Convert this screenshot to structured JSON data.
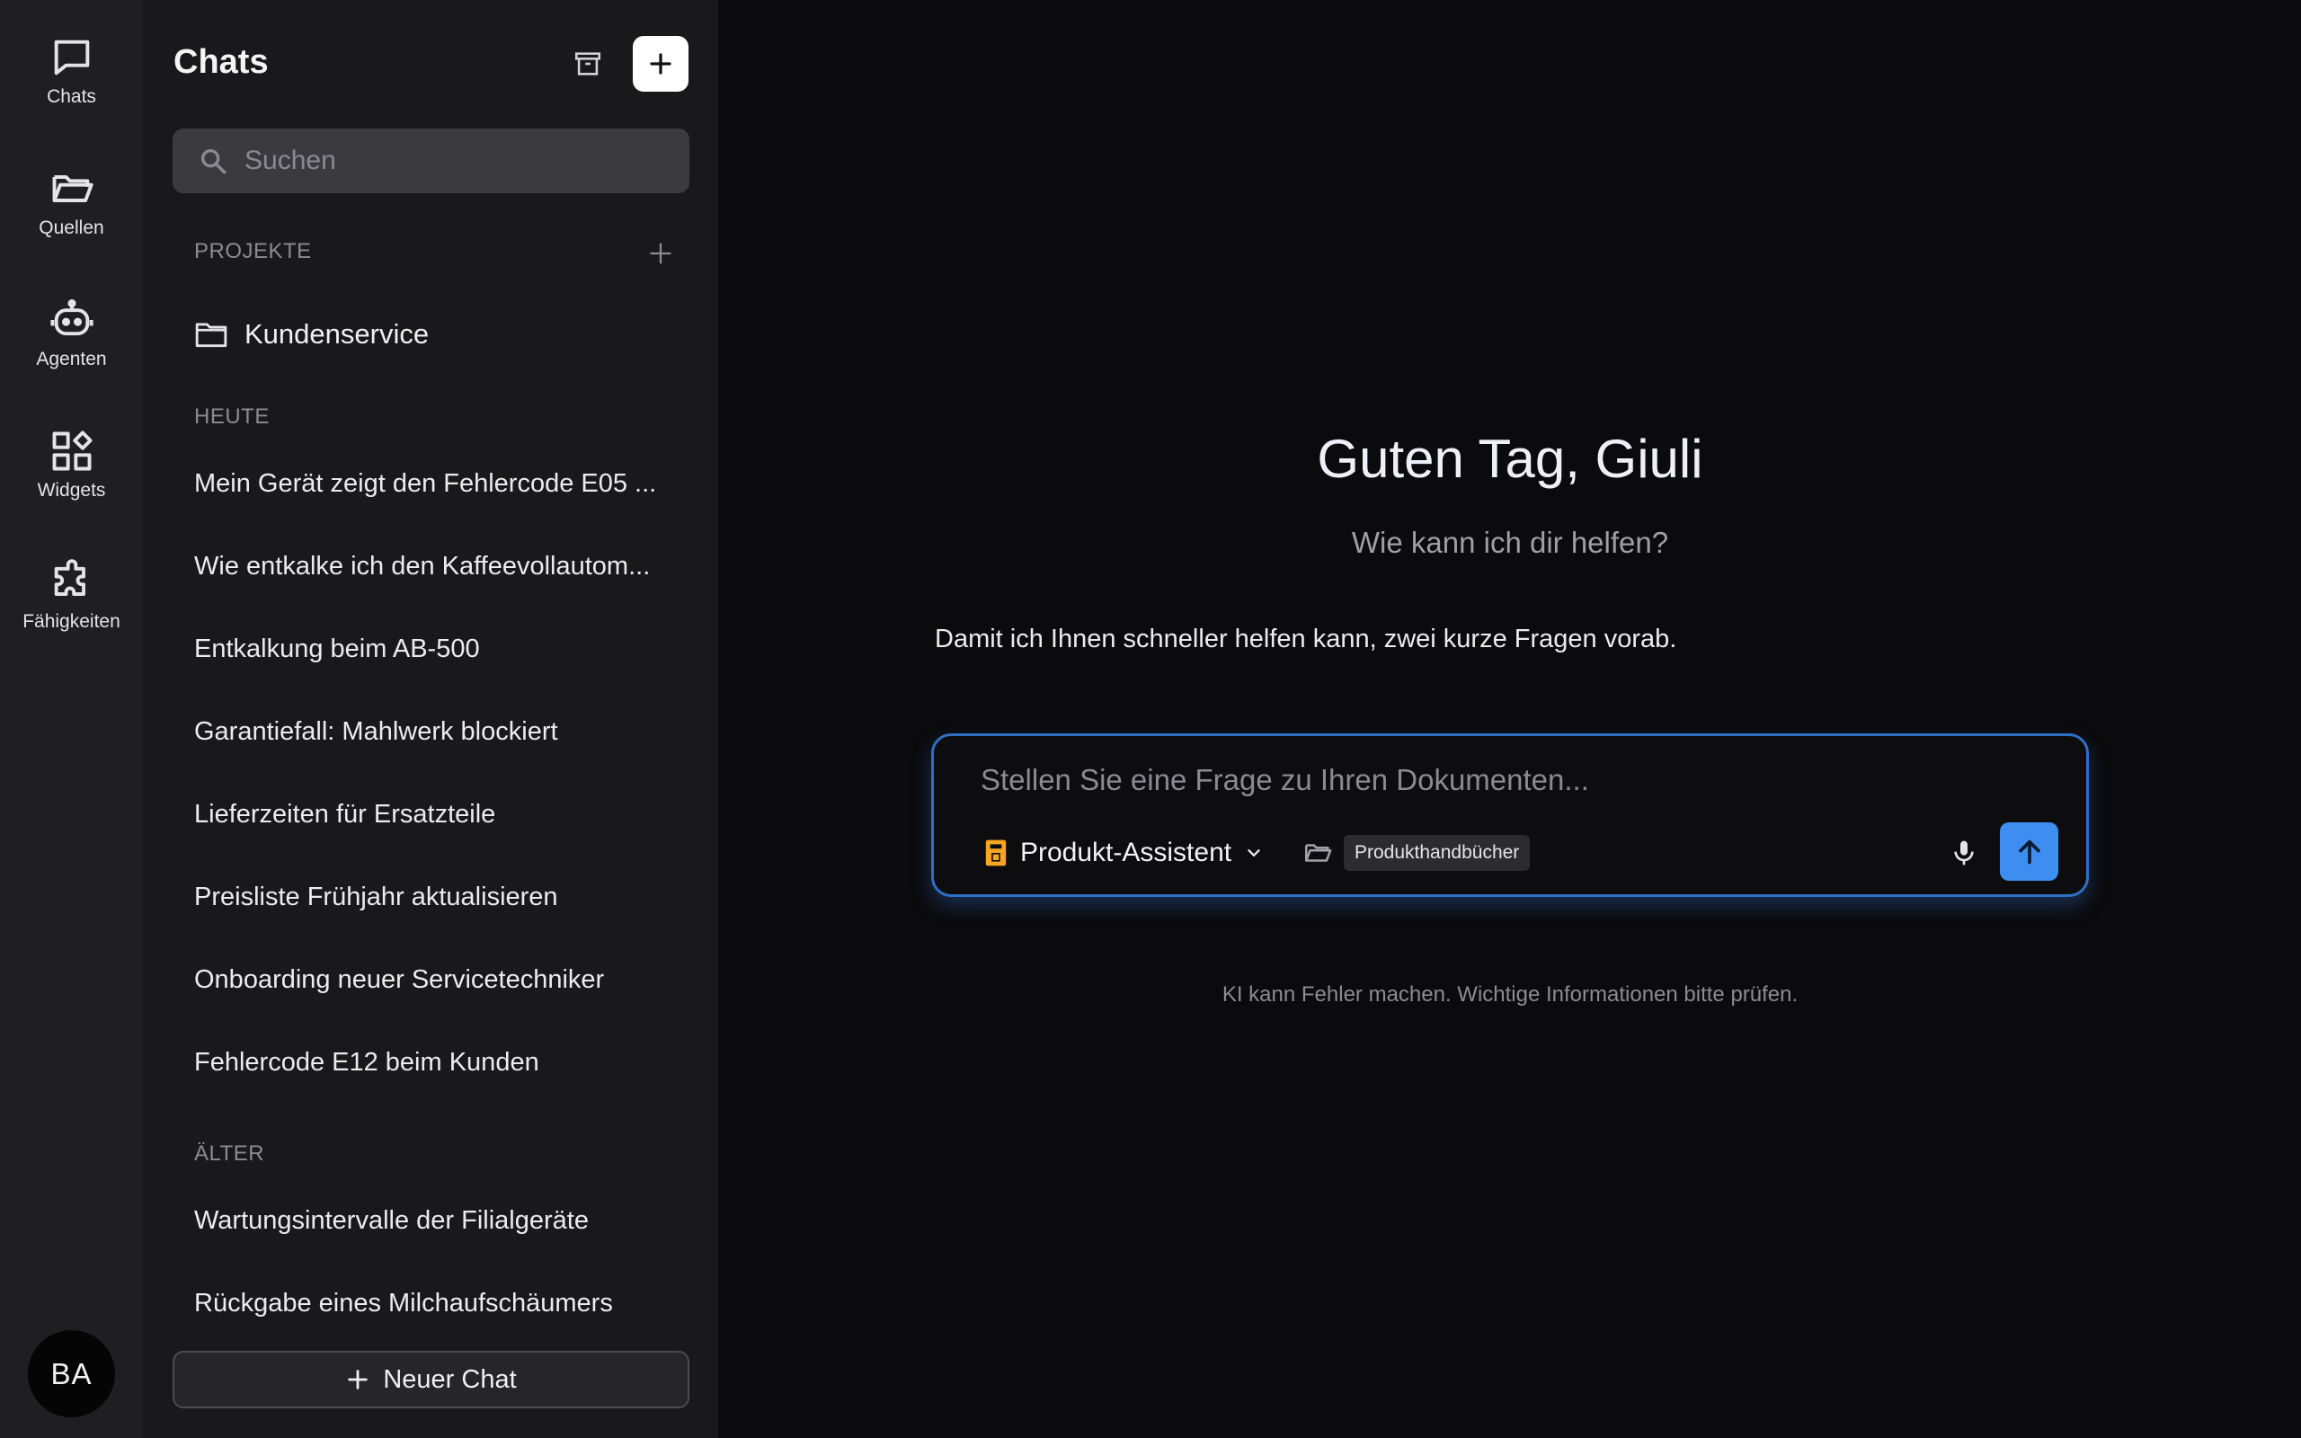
{
  "rail": {
    "items": [
      {
        "label": "Chats",
        "icon": "chat-bubble-icon"
      },
      {
        "label": "Quellen",
        "icon": "folder-open-icon"
      },
      {
        "label": "Agenten",
        "icon": "robot-icon"
      },
      {
        "label": "Widgets",
        "icon": "widgets-icon"
      },
      {
        "label": "Fähigkeiten",
        "icon": "puzzle-icon"
      }
    ],
    "avatar": "BA"
  },
  "panel": {
    "title": "Chats",
    "search_placeholder": "Suchen",
    "projects_header": "PROJEKTE",
    "projects": [
      "Kundenservice"
    ],
    "today_header": "HEUTE",
    "today": [
      "Mein Gerät zeigt den Fehlercode E05 ...",
      "Wie entkalke ich den Kaffeevollautom...",
      "Entkalkung beim AB-500",
      "Garantiefall: Mahlwerk blockiert",
      "Lieferzeiten für Ersatzteile",
      "Preisliste Frühjahr aktualisieren",
      "Onboarding neuer Servicetechniker",
      "Fehlercode E12 beim Kunden"
    ],
    "older_header": "ÄLTER",
    "older": [
      "Wartungsintervalle der Filialgeräte",
      "Rückgabe eines Milchaufschäumers"
    ],
    "new_chat_label": "Neuer Chat"
  },
  "main": {
    "greeting": "Guten Tag, Giuli",
    "subtitle": "Wie kann ich dir helfen?",
    "intro": "Damit ich Ihnen schneller helfen kann, zwei kurze Fragen vorab.",
    "composer": {
      "placeholder": "Stellen Sie eine Frage zu Ihren Dokumenten...",
      "agent": "Produkt-Assistent",
      "source_tag": "Produkthandbücher"
    },
    "disclaimer": "KI kann Fehler machen. Wichtige Informationen bitte prüfen."
  },
  "colors": {
    "accent": "#3d8ef0",
    "composer_border": "#2f6fc4",
    "agent_icon": "#f5a623"
  }
}
